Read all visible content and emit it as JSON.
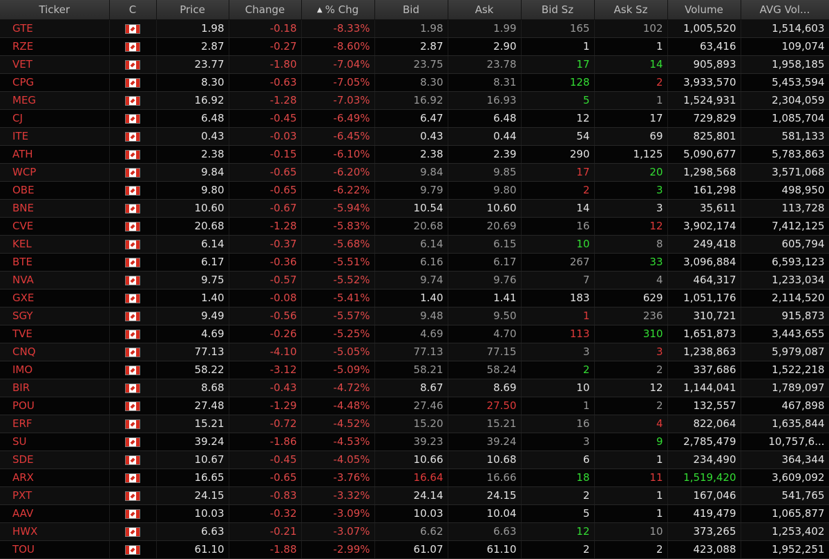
{
  "columns": {
    "ticker": "Ticker",
    "country": "C",
    "price": "Price",
    "change": "Change",
    "pct_chg": "% Chg",
    "bid": "Bid",
    "ask": "Ask",
    "bid_sz": "Bid Sz",
    "ask_sz": "Ask Sz",
    "volume": "Volume",
    "avg_vol": "AVG Vol..."
  },
  "sort": {
    "column": "pct_chg",
    "direction": "ascending",
    "icon": "sort-ascending-icon"
  },
  "colors": {
    "negative": "#e04848",
    "ticker": "#e03a3a",
    "up_tick": "#33dd33",
    "down_tick": "#e03a3a",
    "neutral": "#d8d8d8",
    "stale": "#9a9a9a"
  },
  "rows": [
    {
      "ticker": "GTE",
      "country": "canada-flag-icon",
      "price": "1.98",
      "change": "-0.18",
      "pct_chg": "-8.33%",
      "bid": "1.98",
      "ask": "1.99",
      "bid_sz": "165",
      "ask_sz": "102",
      "volume": "1,005,520",
      "avg_vol": "1,514,603",
      "st": {
        "bid": "dim",
        "ask": "dim",
        "bid_sz": "dim",
        "ask_sz": "dim",
        "volume": "white"
      }
    },
    {
      "ticker": "RZE",
      "country": "canada-flag-icon",
      "price": "2.87",
      "change": "-0.27",
      "pct_chg": "-8.60%",
      "bid": "2.87",
      "ask": "2.90",
      "bid_sz": "1",
      "ask_sz": "1",
      "volume": "63,416",
      "avg_vol": "109,074",
      "st": {}
    },
    {
      "ticker": "VET",
      "country": "canada-flag-icon",
      "price": "23.77",
      "change": "-1.80",
      "pct_chg": "-7.04%",
      "bid": "23.75",
      "ask": "23.78",
      "bid_sz": "17",
      "ask_sz": "14",
      "volume": "905,893",
      "avg_vol": "1,958,185",
      "st": {
        "bid": "dim",
        "ask": "dim",
        "bid_sz": "green",
        "ask_sz": "green"
      }
    },
    {
      "ticker": "CPG",
      "country": "canada-flag-icon",
      "price": "8.30",
      "change": "-0.63",
      "pct_chg": "-7.05%",
      "bid": "8.30",
      "ask": "8.31",
      "bid_sz": "128",
      "ask_sz": "2",
      "volume": "3,933,570",
      "avg_vol": "5,453,594",
      "st": {
        "bid": "dim",
        "ask": "dim",
        "bid_sz": "green",
        "ask_sz": "red"
      }
    },
    {
      "ticker": "MEG",
      "country": "canada-flag-icon",
      "price": "16.92",
      "change": "-1.28",
      "pct_chg": "-7.03%",
      "bid": "16.92",
      "ask": "16.93",
      "bid_sz": "5",
      "ask_sz": "1",
      "volume": "1,524,931",
      "avg_vol": "2,304,059",
      "st": {
        "bid": "dim",
        "ask": "dim",
        "bid_sz": "green",
        "ask_sz": "dim"
      }
    },
    {
      "ticker": "CJ",
      "country": "canada-flag-icon",
      "price": "6.48",
      "change": "-0.45",
      "pct_chg": "-6.49%",
      "bid": "6.47",
      "ask": "6.48",
      "bid_sz": "12",
      "ask_sz": "17",
      "volume": "729,829",
      "avg_vol": "1,085,704",
      "st": {}
    },
    {
      "ticker": "ITE",
      "country": "canada-flag-icon",
      "price": "0.43",
      "change": "-0.03",
      "pct_chg": "-6.45%",
      "bid": "0.43",
      "ask": "0.44",
      "bid_sz": "54",
      "ask_sz": "69",
      "volume": "825,801",
      "avg_vol": "581,133",
      "st": {}
    },
    {
      "ticker": "ATH",
      "country": "canada-flag-icon",
      "price": "2.38",
      "change": "-0.15",
      "pct_chg": "-6.10%",
      "bid": "2.38",
      "ask": "2.39",
      "bid_sz": "290",
      "ask_sz": "1,125",
      "volume": "5,090,677",
      "avg_vol": "5,783,863",
      "st": {}
    },
    {
      "ticker": "WCP",
      "country": "canada-flag-icon",
      "price": "9.84",
      "change": "-0.65",
      "pct_chg": "-6.20%",
      "bid": "9.84",
      "ask": "9.85",
      "bid_sz": "17",
      "ask_sz": "20",
      "volume": "1,298,568",
      "avg_vol": "3,571,068",
      "st": {
        "bid": "dim",
        "ask": "dim",
        "bid_sz": "red",
        "ask_sz": "green"
      }
    },
    {
      "ticker": "OBE",
      "country": "canada-flag-icon",
      "price": "9.80",
      "change": "-0.65",
      "pct_chg": "-6.22%",
      "bid": "9.79",
      "ask": "9.80",
      "bid_sz": "2",
      "ask_sz": "3",
      "volume": "161,298",
      "avg_vol": "498,950",
      "st": {
        "bid": "dim",
        "ask": "dim",
        "bid_sz": "red",
        "ask_sz": "green"
      }
    },
    {
      "ticker": "BNE",
      "country": "canada-flag-icon",
      "price": "10.60",
      "change": "-0.67",
      "pct_chg": "-5.94%",
      "bid": "10.54",
      "ask": "10.60",
      "bid_sz": "14",
      "ask_sz": "3",
      "volume": "35,611",
      "avg_vol": "113,728",
      "st": {}
    },
    {
      "ticker": "CVE",
      "country": "canada-flag-icon",
      "price": "20.68",
      "change": "-1.28",
      "pct_chg": "-5.83%",
      "bid": "20.68",
      "ask": "20.69",
      "bid_sz": "16",
      "ask_sz": "12",
      "volume": "3,902,174",
      "avg_vol": "7,412,125",
      "st": {
        "bid": "dim",
        "ask": "dim",
        "bid_sz": "dim",
        "ask_sz": "red"
      }
    },
    {
      "ticker": "KEL",
      "country": "canada-flag-icon",
      "price": "6.14",
      "change": "-0.37",
      "pct_chg": "-5.68%",
      "bid": "6.14",
      "ask": "6.15",
      "bid_sz": "10",
      "ask_sz": "8",
      "volume": "249,418",
      "avg_vol": "605,794",
      "st": {
        "bid": "dim",
        "ask": "dim",
        "bid_sz": "green",
        "ask_sz": "dim"
      }
    },
    {
      "ticker": "BTE",
      "country": "canada-flag-icon",
      "price": "6.17",
      "change": "-0.36",
      "pct_chg": "-5.51%",
      "bid": "6.16",
      "ask": "6.17",
      "bid_sz": "267",
      "ask_sz": "33",
      "volume": "3,096,884",
      "avg_vol": "6,593,123",
      "st": {
        "bid": "dim",
        "ask": "dim",
        "bid_sz": "dim",
        "ask_sz": "green"
      }
    },
    {
      "ticker": "NVA",
      "country": "canada-flag-icon",
      "price": "9.75",
      "change": "-0.57",
      "pct_chg": "-5.52%",
      "bid": "9.74",
      "ask": "9.76",
      "bid_sz": "7",
      "ask_sz": "4",
      "volume": "464,317",
      "avg_vol": "1,233,034",
      "st": {
        "bid": "dim",
        "ask": "dim",
        "bid_sz": "dim",
        "ask_sz": "dim"
      }
    },
    {
      "ticker": "GXE",
      "country": "canada-flag-icon",
      "price": "1.40",
      "change": "-0.08",
      "pct_chg": "-5.41%",
      "bid": "1.40",
      "ask": "1.41",
      "bid_sz": "183",
      "ask_sz": "629",
      "volume": "1,051,176",
      "avg_vol": "2,114,520",
      "st": {}
    },
    {
      "ticker": "SGY",
      "country": "canada-flag-icon",
      "price": "9.49",
      "change": "-0.56",
      "pct_chg": "-5.57%",
      "bid": "9.48",
      "ask": "9.50",
      "bid_sz": "1",
      "ask_sz": "236",
      "volume": "310,721",
      "avg_vol": "915,873",
      "st": {
        "bid": "dim",
        "ask": "dim",
        "bid_sz": "red",
        "ask_sz": "dim"
      }
    },
    {
      "ticker": "TVE",
      "country": "canada-flag-icon",
      "price": "4.69",
      "change": "-0.26",
      "pct_chg": "-5.25%",
      "bid": "4.69",
      "ask": "4.70",
      "bid_sz": "113",
      "ask_sz": "310",
      "volume": "1,651,873",
      "avg_vol": "3,443,655",
      "st": {
        "bid": "dim",
        "ask": "dim",
        "bid_sz": "red",
        "ask_sz": "green"
      }
    },
    {
      "ticker": "CNQ",
      "country": "canada-flag-icon",
      "price": "77.13",
      "change": "-4.10",
      "pct_chg": "-5.05%",
      "bid": "77.13",
      "ask": "77.15",
      "bid_sz": "3",
      "ask_sz": "3",
      "volume": "1,238,863",
      "avg_vol": "5,979,087",
      "st": {
        "bid": "dim",
        "ask": "dim",
        "bid_sz": "dim",
        "ask_sz": "red"
      }
    },
    {
      "ticker": "IMO",
      "country": "canada-flag-icon",
      "price": "58.22",
      "change": "-3.12",
      "pct_chg": "-5.09%",
      "bid": "58.21",
      "ask": "58.24",
      "bid_sz": "2",
      "ask_sz": "2",
      "volume": "337,686",
      "avg_vol": "1,522,218",
      "st": {
        "bid": "dim",
        "ask": "dim",
        "bid_sz": "green",
        "ask_sz": "dim"
      }
    },
    {
      "ticker": "BIR",
      "country": "canada-flag-icon",
      "price": "8.68",
      "change": "-0.43",
      "pct_chg": "-4.72%",
      "bid": "8.67",
      "ask": "8.69",
      "bid_sz": "10",
      "ask_sz": "12",
      "volume": "1,144,041",
      "avg_vol": "1,789,097",
      "st": {}
    },
    {
      "ticker": "POU",
      "country": "canada-flag-icon",
      "price": "27.48",
      "change": "-1.29",
      "pct_chg": "-4.48%",
      "bid": "27.46",
      "ask": "27.50",
      "bid_sz": "1",
      "ask_sz": "2",
      "volume": "132,557",
      "avg_vol": "467,898",
      "st": {
        "bid": "dim",
        "ask": "red",
        "bid_sz": "dim",
        "ask_sz": "dim"
      }
    },
    {
      "ticker": "ERF",
      "country": "canada-flag-icon",
      "price": "15.21",
      "change": "-0.72",
      "pct_chg": "-4.52%",
      "bid": "15.20",
      "ask": "15.21",
      "bid_sz": "16",
      "ask_sz": "4",
      "volume": "822,064",
      "avg_vol": "1,635,844",
      "st": {
        "bid": "dim",
        "ask": "dim",
        "bid_sz": "dim",
        "ask_sz": "red"
      }
    },
    {
      "ticker": "SU",
      "country": "canada-flag-icon",
      "price": "39.24",
      "change": "-1.86",
      "pct_chg": "-4.53%",
      "bid": "39.23",
      "ask": "39.24",
      "bid_sz": "3",
      "ask_sz": "9",
      "volume": "2,785,479",
      "avg_vol": "10,757,6...",
      "st": {
        "bid": "dim",
        "ask": "dim",
        "bid_sz": "dim",
        "ask_sz": "green"
      }
    },
    {
      "ticker": "SDE",
      "country": "canada-flag-icon",
      "price": "10.67",
      "change": "-0.45",
      "pct_chg": "-4.05%",
      "bid": "10.66",
      "ask": "10.68",
      "bid_sz": "6",
      "ask_sz": "1",
      "volume": "234,490",
      "avg_vol": "364,344",
      "st": {}
    },
    {
      "ticker": "ARX",
      "country": "canada-flag-icon",
      "price": "16.65",
      "change": "-0.65",
      "pct_chg": "-3.76%",
      "bid": "16.64",
      "ask": "16.66",
      "bid_sz": "18",
      "ask_sz": "11",
      "volume": "1,519,420",
      "avg_vol": "3,609,092",
      "st": {
        "bid": "red",
        "ask": "dim",
        "bid_sz": "green",
        "ask_sz": "red",
        "volume": "green"
      }
    },
    {
      "ticker": "PXT",
      "country": "canada-flag-icon",
      "price": "24.15",
      "change": "-0.83",
      "pct_chg": "-3.32%",
      "bid": "24.14",
      "ask": "24.15",
      "bid_sz": "2",
      "ask_sz": "1",
      "volume": "167,046",
      "avg_vol": "541,765",
      "st": {}
    },
    {
      "ticker": "AAV",
      "country": "canada-flag-icon",
      "price": "10.03",
      "change": "-0.32",
      "pct_chg": "-3.09%",
      "bid": "10.03",
      "ask": "10.04",
      "bid_sz": "5",
      "ask_sz": "1",
      "volume": "419,479",
      "avg_vol": "1,065,877",
      "st": {}
    },
    {
      "ticker": "HWX",
      "country": "canada-flag-icon",
      "price": "6.63",
      "change": "-0.21",
      "pct_chg": "-3.07%",
      "bid": "6.62",
      "ask": "6.63",
      "bid_sz": "12",
      "ask_sz": "10",
      "volume": "373,265",
      "avg_vol": "1,253,402",
      "st": {
        "bid": "dim",
        "ask": "dim",
        "bid_sz": "green",
        "ask_sz": "dim"
      }
    },
    {
      "ticker": "TOU",
      "country": "canada-flag-icon",
      "price": "61.10",
      "change": "-1.88",
      "pct_chg": "-2.99%",
      "bid": "61.07",
      "ask": "61.10",
      "bid_sz": "2",
      "ask_sz": "2",
      "volume": "423,088",
      "avg_vol": "1,952,251",
      "st": {}
    }
  ]
}
